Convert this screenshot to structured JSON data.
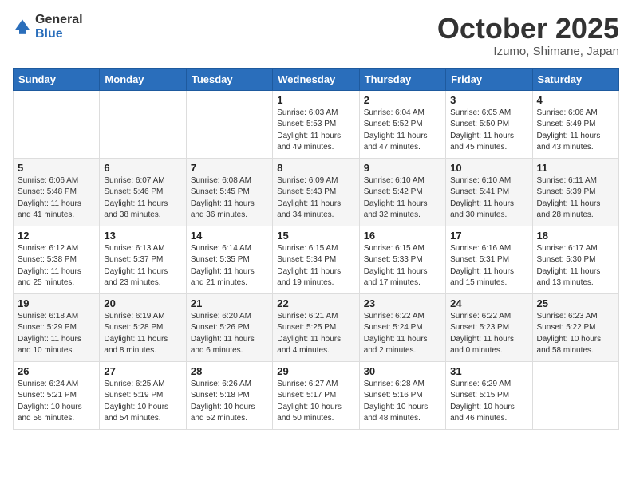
{
  "header": {
    "logo_general": "General",
    "logo_blue": "Blue",
    "month_title": "October 2025",
    "location": "Izumo, Shimane, Japan"
  },
  "weekdays": [
    "Sunday",
    "Monday",
    "Tuesday",
    "Wednesday",
    "Thursday",
    "Friday",
    "Saturday"
  ],
  "weeks": [
    [
      {
        "day": "",
        "info": ""
      },
      {
        "day": "",
        "info": ""
      },
      {
        "day": "",
        "info": ""
      },
      {
        "day": "1",
        "info": "Sunrise: 6:03 AM\nSunset: 5:53 PM\nDaylight: 11 hours\nand 49 minutes."
      },
      {
        "day": "2",
        "info": "Sunrise: 6:04 AM\nSunset: 5:52 PM\nDaylight: 11 hours\nand 47 minutes."
      },
      {
        "day": "3",
        "info": "Sunrise: 6:05 AM\nSunset: 5:50 PM\nDaylight: 11 hours\nand 45 minutes."
      },
      {
        "day": "4",
        "info": "Sunrise: 6:06 AM\nSunset: 5:49 PM\nDaylight: 11 hours\nand 43 minutes."
      }
    ],
    [
      {
        "day": "5",
        "info": "Sunrise: 6:06 AM\nSunset: 5:48 PM\nDaylight: 11 hours\nand 41 minutes."
      },
      {
        "day": "6",
        "info": "Sunrise: 6:07 AM\nSunset: 5:46 PM\nDaylight: 11 hours\nand 38 minutes."
      },
      {
        "day": "7",
        "info": "Sunrise: 6:08 AM\nSunset: 5:45 PM\nDaylight: 11 hours\nand 36 minutes."
      },
      {
        "day": "8",
        "info": "Sunrise: 6:09 AM\nSunset: 5:43 PM\nDaylight: 11 hours\nand 34 minutes."
      },
      {
        "day": "9",
        "info": "Sunrise: 6:10 AM\nSunset: 5:42 PM\nDaylight: 11 hours\nand 32 minutes."
      },
      {
        "day": "10",
        "info": "Sunrise: 6:10 AM\nSunset: 5:41 PM\nDaylight: 11 hours\nand 30 minutes."
      },
      {
        "day": "11",
        "info": "Sunrise: 6:11 AM\nSunset: 5:39 PM\nDaylight: 11 hours\nand 28 minutes."
      }
    ],
    [
      {
        "day": "12",
        "info": "Sunrise: 6:12 AM\nSunset: 5:38 PM\nDaylight: 11 hours\nand 25 minutes."
      },
      {
        "day": "13",
        "info": "Sunrise: 6:13 AM\nSunset: 5:37 PM\nDaylight: 11 hours\nand 23 minutes."
      },
      {
        "day": "14",
        "info": "Sunrise: 6:14 AM\nSunset: 5:35 PM\nDaylight: 11 hours\nand 21 minutes."
      },
      {
        "day": "15",
        "info": "Sunrise: 6:15 AM\nSunset: 5:34 PM\nDaylight: 11 hours\nand 19 minutes."
      },
      {
        "day": "16",
        "info": "Sunrise: 6:15 AM\nSunset: 5:33 PM\nDaylight: 11 hours\nand 17 minutes."
      },
      {
        "day": "17",
        "info": "Sunrise: 6:16 AM\nSunset: 5:31 PM\nDaylight: 11 hours\nand 15 minutes."
      },
      {
        "day": "18",
        "info": "Sunrise: 6:17 AM\nSunset: 5:30 PM\nDaylight: 11 hours\nand 13 minutes."
      }
    ],
    [
      {
        "day": "19",
        "info": "Sunrise: 6:18 AM\nSunset: 5:29 PM\nDaylight: 11 hours\nand 10 minutes."
      },
      {
        "day": "20",
        "info": "Sunrise: 6:19 AM\nSunset: 5:28 PM\nDaylight: 11 hours\nand 8 minutes."
      },
      {
        "day": "21",
        "info": "Sunrise: 6:20 AM\nSunset: 5:26 PM\nDaylight: 11 hours\nand 6 minutes."
      },
      {
        "day": "22",
        "info": "Sunrise: 6:21 AM\nSunset: 5:25 PM\nDaylight: 11 hours\nand 4 minutes."
      },
      {
        "day": "23",
        "info": "Sunrise: 6:22 AM\nSunset: 5:24 PM\nDaylight: 11 hours\nand 2 minutes."
      },
      {
        "day": "24",
        "info": "Sunrise: 6:22 AM\nSunset: 5:23 PM\nDaylight: 11 hours\nand 0 minutes."
      },
      {
        "day": "25",
        "info": "Sunrise: 6:23 AM\nSunset: 5:22 PM\nDaylight: 10 hours\nand 58 minutes."
      }
    ],
    [
      {
        "day": "26",
        "info": "Sunrise: 6:24 AM\nSunset: 5:21 PM\nDaylight: 10 hours\nand 56 minutes."
      },
      {
        "day": "27",
        "info": "Sunrise: 6:25 AM\nSunset: 5:19 PM\nDaylight: 10 hours\nand 54 minutes."
      },
      {
        "day": "28",
        "info": "Sunrise: 6:26 AM\nSunset: 5:18 PM\nDaylight: 10 hours\nand 52 minutes."
      },
      {
        "day": "29",
        "info": "Sunrise: 6:27 AM\nSunset: 5:17 PM\nDaylight: 10 hours\nand 50 minutes."
      },
      {
        "day": "30",
        "info": "Sunrise: 6:28 AM\nSunset: 5:16 PM\nDaylight: 10 hours\nand 48 minutes."
      },
      {
        "day": "31",
        "info": "Sunrise: 6:29 AM\nSunset: 5:15 PM\nDaylight: 10 hours\nand 46 minutes."
      },
      {
        "day": "",
        "info": ""
      }
    ]
  ]
}
